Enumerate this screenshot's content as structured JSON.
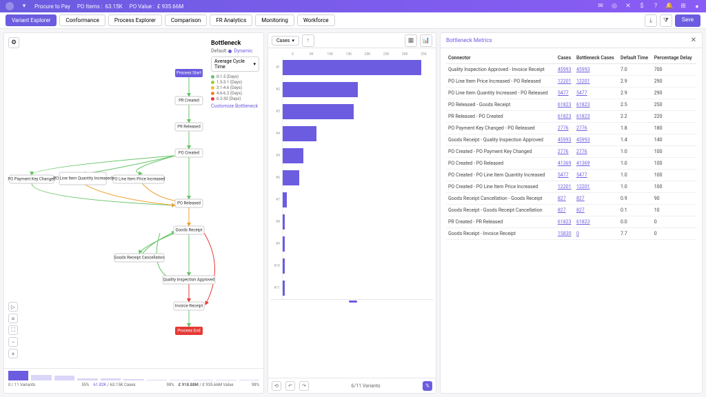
{
  "header": {
    "crumb": "Procure to Pay",
    "po_items_label": "PO Items :",
    "po_items_value": "63.15K",
    "po_value_label": "PO Value :",
    "po_value_value": "£ 935.66M"
  },
  "tabs": {
    "items": [
      "Variant Explorer",
      "Conformance",
      "Process Explorer",
      "Comparison",
      "FR Analytics",
      "Monitoring",
      "Workforce"
    ],
    "active_index": 0,
    "save_label": "Save"
  },
  "legend": {
    "title": "Bottleneck",
    "subtitle": "Default",
    "dynamic_label": "Dynamic",
    "selector": "Average Cycle Time",
    "customize": "Customize Bottleneck",
    "items": [
      {
        "label": "0-1.5 (Days)",
        "color": "#65c466"
      },
      {
        "label": "1.5-3.1 (Days)",
        "color": "#9ccc3c"
      },
      {
        "label": "3.1-4.6 (Days)",
        "color": "#f0c030"
      },
      {
        "label": "4.6-6.2 (Days)",
        "color": "#f08030"
      },
      {
        "label": "6.2-30 (Days)",
        "color": "#e53935"
      }
    ]
  },
  "nodes": {
    "start": "Process Start",
    "pr_created": "PR Created",
    "pr_released": "PR Released",
    "po_created": "PO Created",
    "po_payment_key": "PO Payment Key Changed",
    "po_qty": "PO Line Item Quantity Increased",
    "po_price": "PO Line Item Price Increased",
    "po_released": "PO Released",
    "goods_receipt": "Goods Receipt",
    "goods_cancel": "Goods Receipt Cancellation",
    "quality": "Quality Inspection Approved",
    "invoice": "Invoice Receipt",
    "end": "Process End"
  },
  "variant_footer": {
    "seg1_left": "0 / 11 Variants",
    "seg1_right": "55%",
    "seg2_left": "61.82K",
    "seg2_mid": "/ 63.15K Cases",
    "seg2_right": "98%",
    "seg3_left": "£ 918.88M",
    "seg3_mid": "/ £ 935.66M Value",
    "seg3_right": "98%"
  },
  "chart_header": {
    "selector": "Cases"
  },
  "chart_footer": {
    "mid": "6/11 Variants"
  },
  "chart_data": {
    "type": "bar",
    "orientation": "horizontal",
    "categories": [
      "#1",
      "#2",
      "#3",
      "#4",
      "#5",
      "#6",
      "#7",
      "#8",
      "#9",
      "#10",
      "#11"
    ],
    "values": [
      66,
      36,
      34,
      16,
      10,
      8,
      2,
      1,
      1,
      1,
      1
    ],
    "xlabel": "",
    "ylabel": "",
    "xlim": [
      0,
      70
    ],
    "x_ticks": [
      "0",
      "5K",
      "10K",
      "15K",
      "20K",
      "25K",
      "30K",
      "35K"
    ],
    "title": ""
  },
  "metrics": {
    "title": "Bottleneck Metrics",
    "columns": [
      "Connector",
      "Cases",
      "Bottleneck Cases",
      "Default Time",
      "Percentage Delay"
    ],
    "rows": [
      {
        "connector": "Quality Inspection Approved - Invoice Receipt",
        "cases": "45993",
        "bcases": "45993",
        "dtime": "7.0",
        "delay": "700"
      },
      {
        "connector": "PO Line Item Price Increased - PO Released",
        "cases": "12201",
        "bcases": "12201",
        "dtime": "2.9",
        "delay": "290"
      },
      {
        "connector": "PO Line Item Quantity Increased - PO Released",
        "cases": "5477",
        "bcases": "5477",
        "dtime": "2.9",
        "delay": "290"
      },
      {
        "connector": "PO Released - Goods Receipt",
        "cases": "61823",
        "bcases": "61823",
        "dtime": "2.5",
        "delay": "250"
      },
      {
        "connector": "PR Released - PO Created",
        "cases": "61823",
        "bcases": "61823",
        "dtime": "2.2",
        "delay": "220"
      },
      {
        "connector": "PO Payment Key Changed - PO Released",
        "cases": "2776",
        "bcases": "2776",
        "dtime": "1.8",
        "delay": "180"
      },
      {
        "connector": "Goods Receipt - Quality Inspection Approved",
        "cases": "45993",
        "bcases": "45993",
        "dtime": "1.4",
        "delay": "140"
      },
      {
        "connector": "PO Created - PO Payment Key Changed",
        "cases": "2776",
        "bcases": "2776",
        "dtime": "1.0",
        "delay": "100"
      },
      {
        "connector": "PO Created - PO Released",
        "cases": "41369",
        "bcases": "41369",
        "dtime": "1.0",
        "delay": "100"
      },
      {
        "connector": "PO Created - PO Line Item Quantity Increased",
        "cases": "5477",
        "bcases": "5477",
        "dtime": "1.0",
        "delay": "100"
      },
      {
        "connector": "PO Created - PO Line Item Price Increased",
        "cases": "12201",
        "bcases": "12201",
        "dtime": "1.0",
        "delay": "100"
      },
      {
        "connector": "Goods Receipt Cancellation - Goods Receipt",
        "cases": "827",
        "bcases": "827",
        "dtime": "0.9",
        "delay": "90"
      },
      {
        "connector": "Goods Receipt - Goods Receipt Cancellation",
        "cases": "827",
        "bcases": "827",
        "dtime": "0.1",
        "delay": "10"
      },
      {
        "connector": "PR Created - PR Released",
        "cases": "61823",
        "bcases": "61823",
        "dtime": "0.0",
        "delay": "0"
      },
      {
        "connector": "Goods Receipt - Invoice Receipt",
        "cases": "15830",
        "bcases": "0",
        "dtime": "7.7",
        "delay": "0"
      }
    ]
  }
}
